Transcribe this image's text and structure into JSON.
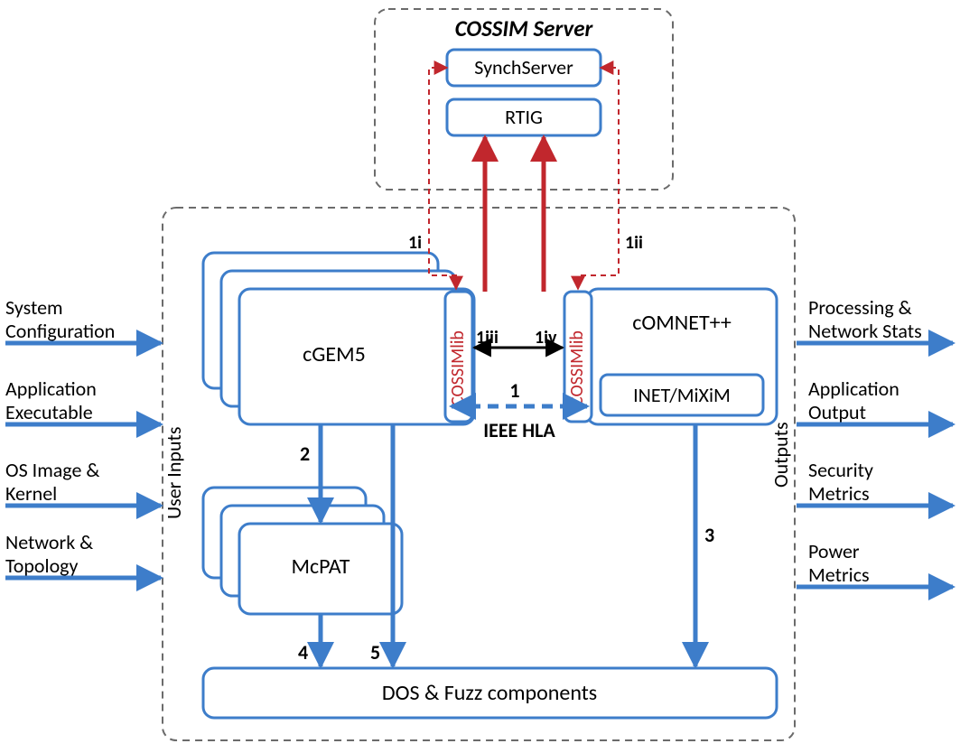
{
  "server": {
    "title": "COSSIM Server",
    "synch": "SynchServer",
    "rtig": "RTIG"
  },
  "blocks": {
    "cgem5": "cGEM5",
    "comnet": "cOMNET++",
    "inet": "INET/MiXiM",
    "mcpat": "McPAT",
    "dos": "DOS & Fuzz components",
    "cossimlib": "COSSIMlib"
  },
  "labels": {
    "ieee": "IEEE HLA",
    "userInputs": "User Inputs",
    "outputs": "Outputs",
    "e1": "1",
    "e1i": "1i",
    "e1ii": "1ii",
    "e1iii": "1iii",
    "e1iv": "1iv",
    "e2": "2",
    "e3": "3",
    "e4": "4",
    "e5": "5"
  },
  "inputs": [
    "System Configuration",
    "Application Executable",
    "OS Image & Kernel",
    "Network & Topology"
  ],
  "outputs": [
    "Processing & Network Stats",
    "Application Output",
    "Security Metrics",
    "Power Metrics"
  ],
  "colors": {
    "blue": "#3d7dca",
    "red": "#c1272d",
    "gray": "#6b6b6b"
  }
}
